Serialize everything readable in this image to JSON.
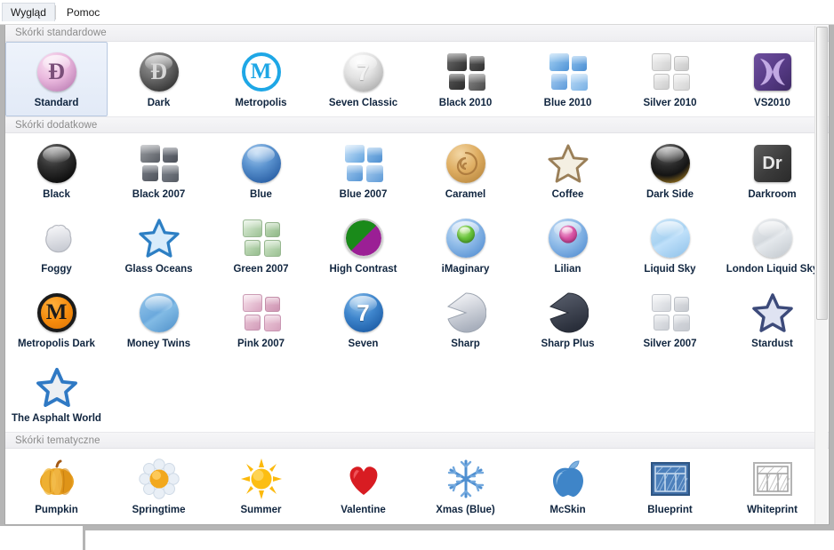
{
  "menubar": {
    "items": [
      {
        "label": "Wygląd",
        "active": true
      },
      {
        "label": "Pomoc",
        "active": false
      }
    ]
  },
  "sections": [
    {
      "header": "Skórki standardowe",
      "items": [
        {
          "label": "Standard",
          "icon": "sphere-pink-logo",
          "selected": true
        },
        {
          "label": "Dark",
          "icon": "sphere-dark-logo",
          "selected": false
        },
        {
          "label": "Metropolis",
          "icon": "ring-m-blue",
          "selected": false
        },
        {
          "label": "Seven Classic",
          "icon": "sphere-silver-7",
          "selected": false
        },
        {
          "label": "Black 2010",
          "icon": "tiles-black",
          "selected": false
        },
        {
          "label": "Blue 2010",
          "icon": "tiles-blue",
          "selected": false
        },
        {
          "label": "Silver 2010",
          "icon": "tiles-silver",
          "selected": false
        },
        {
          "label": "VS2010",
          "icon": "vs2010-purple-x",
          "selected": false
        }
      ]
    },
    {
      "header": "Skórki dodatkowe",
      "items": [
        {
          "label": "Black",
          "icon": "sphere-black",
          "selected": false
        },
        {
          "label": "Black 2007",
          "icon": "tiles-black2007",
          "selected": false
        },
        {
          "label": "Blue",
          "icon": "sphere-blue",
          "selected": false
        },
        {
          "label": "Blue 2007",
          "icon": "tiles-blue2007",
          "selected": false
        },
        {
          "label": "Caramel",
          "icon": "swirl-caramel",
          "selected": false
        },
        {
          "label": "Coffee",
          "icon": "star-coffee",
          "selected": false
        },
        {
          "label": "Dark Side",
          "icon": "sphere-darkside",
          "selected": false
        },
        {
          "label": "Darkroom",
          "icon": "badge-dr",
          "selected": false
        },
        {
          "label": "Foggy",
          "icon": "cloud-foggy",
          "selected": false
        },
        {
          "label": "Glass Oceans",
          "icon": "star-blue",
          "selected": false
        },
        {
          "label": "Green 2007",
          "icon": "tiles-green",
          "selected": false
        },
        {
          "label": "High Contrast",
          "icon": "split-greenpurple",
          "selected": false
        },
        {
          "label": "iMaginary",
          "icon": "ball-in-ball-green",
          "selected": false
        },
        {
          "label": "Lilian",
          "icon": "ball-in-ball-pink",
          "selected": false
        },
        {
          "label": "Liquid Sky",
          "icon": "sphere-liquidsky",
          "selected": false
        },
        {
          "label": "London Liquid Sky",
          "icon": "sphere-london",
          "selected": false
        },
        {
          "label": "Metropolis Dark",
          "icon": "circle-m-orange",
          "selected": false
        },
        {
          "label": "Money Twins",
          "icon": "sphere-money",
          "selected": false
        },
        {
          "label": "Pink 2007",
          "icon": "tiles-pink",
          "selected": false
        },
        {
          "label": "Seven",
          "icon": "sphere-blue-7",
          "selected": false
        },
        {
          "label": "Sharp",
          "icon": "pac-silver",
          "selected": false
        },
        {
          "label": "Sharp Plus",
          "icon": "pac-dark",
          "selected": false
        },
        {
          "label": "Silver 2007",
          "icon": "tiles-silver2007",
          "selected": false
        },
        {
          "label": "Stardust",
          "icon": "star-stardust",
          "selected": false
        },
        {
          "label": "The Asphalt World",
          "icon": "star-asphalt",
          "selected": false
        }
      ]
    },
    {
      "header": "Skórki tematyczne",
      "items": [
        {
          "label": "Pumpkin",
          "icon": "pumpkin",
          "selected": false
        },
        {
          "label": "Springtime",
          "icon": "daisy",
          "selected": false
        },
        {
          "label": "Summer",
          "icon": "sun",
          "selected": false
        },
        {
          "label": "Valentine",
          "icon": "heart",
          "selected": false
        },
        {
          "label": "Xmas (Blue)",
          "icon": "snowflake",
          "selected": false
        },
        {
          "label": "McSkin",
          "icon": "apple-blue",
          "selected": false
        },
        {
          "label": "Blueprint",
          "icon": "blueprint",
          "selected": false
        },
        {
          "label": "Whiteprint",
          "icon": "whiteprint",
          "selected": false
        }
      ]
    }
  ],
  "colors": {
    "selection_fill": "#e8eff9",
    "selection_border": "#b8c8e0",
    "label_text": "#10253f",
    "section_header_text": "#8b8b8b",
    "panel_border": "#a8a8a8",
    "accent_blue": "#1ea7e6",
    "accent_orange": "#f28a0a",
    "accent_purple": "#7b5ea8"
  }
}
